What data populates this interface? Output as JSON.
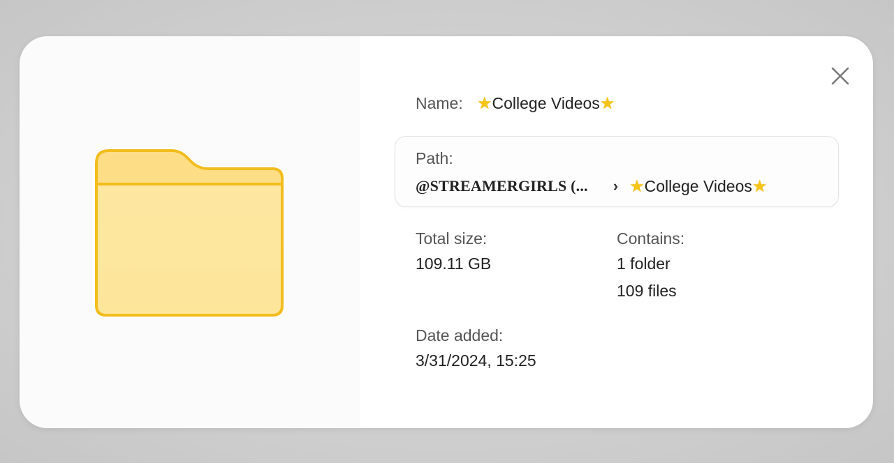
{
  "dialog": {
    "icon": "folder-icon",
    "close_icon": "close-icon",
    "name_label": "Name:",
    "name_star_icon": "star-icon",
    "name_value": "College Videos",
    "path": {
      "label": "Path:",
      "root": "@STREAMERGIRLS (...",
      "separator_icon": "chevron-right-icon",
      "separator": "›",
      "current": "College Videos"
    },
    "total_size": {
      "label": "Total size:",
      "value": "109.11 GB"
    },
    "contains": {
      "label": "Contains:",
      "folders": "1 folder",
      "files": "109 files"
    },
    "date_added": {
      "label": "Date added:",
      "value": "3/31/2024, 15:25"
    }
  },
  "colors": {
    "folder_fill": "#fde69a",
    "folder_tab": "#fcd97a",
    "folder_stroke": "#f2bd1d",
    "star": "#f5c518",
    "background": "#d4d4d4"
  }
}
